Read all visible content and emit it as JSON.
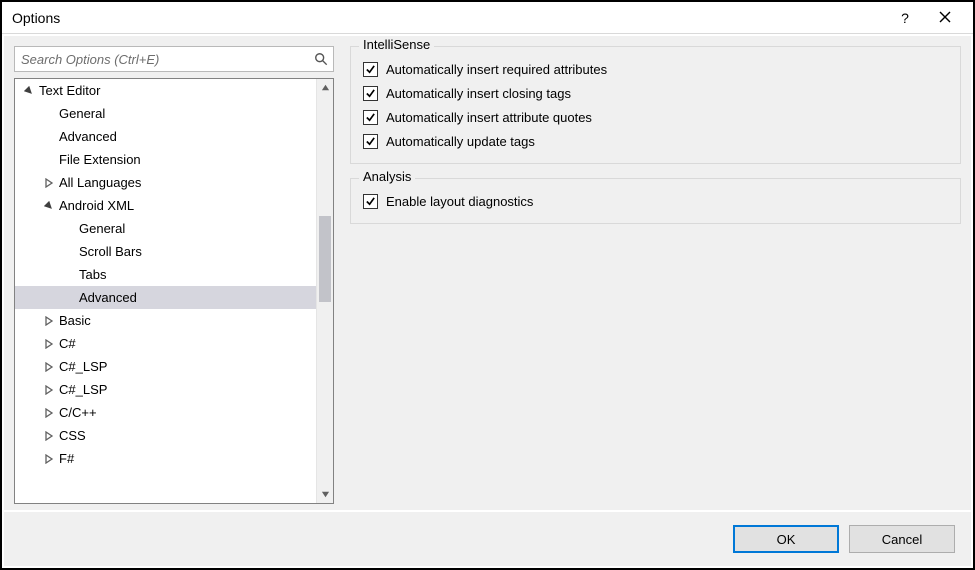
{
  "window": {
    "title": "Options"
  },
  "search": {
    "placeholder": "Search Options (Ctrl+E)",
    "value": ""
  },
  "tree": [
    {
      "label": "Text Editor",
      "depth": 0,
      "expander": "open",
      "selected": false
    },
    {
      "label": "General",
      "depth": 1,
      "expander": "none",
      "selected": false
    },
    {
      "label": "Advanced",
      "depth": 1,
      "expander": "none",
      "selected": false
    },
    {
      "label": "File Extension",
      "depth": 1,
      "expander": "none",
      "selected": false
    },
    {
      "label": "All Languages",
      "depth": 1,
      "expander": "closed",
      "selected": false
    },
    {
      "label": "Android XML",
      "depth": 1,
      "expander": "open",
      "selected": false
    },
    {
      "label": "General",
      "depth": 2,
      "expander": "none",
      "selected": false
    },
    {
      "label": "Scroll Bars",
      "depth": 2,
      "expander": "none",
      "selected": false
    },
    {
      "label": "Tabs",
      "depth": 2,
      "expander": "none",
      "selected": false
    },
    {
      "label": "Advanced",
      "depth": 2,
      "expander": "none",
      "selected": true
    },
    {
      "label": "Basic",
      "depth": 1,
      "expander": "closed",
      "selected": false
    },
    {
      "label": "C#",
      "depth": 1,
      "expander": "closed",
      "selected": false
    },
    {
      "label": "C#_LSP",
      "depth": 1,
      "expander": "closed",
      "selected": false
    },
    {
      "label": "C#_LSP",
      "depth": 1,
      "expander": "closed",
      "selected": false
    },
    {
      "label": "C/C++",
      "depth": 1,
      "expander": "closed",
      "selected": false
    },
    {
      "label": "CSS",
      "depth": 1,
      "expander": "closed",
      "selected": false
    },
    {
      "label": "F#",
      "depth": 1,
      "expander": "closed",
      "selected": false
    }
  ],
  "groups": [
    {
      "legend": "IntelliSense",
      "options": [
        {
          "label": "Automatically insert required attributes",
          "checked": true
        },
        {
          "label": "Automatically insert closing tags",
          "checked": true
        },
        {
          "label": "Automatically insert attribute quotes",
          "checked": true
        },
        {
          "label": "Automatically update tags",
          "checked": true
        }
      ]
    },
    {
      "legend": "Analysis",
      "options": [
        {
          "label": "Enable layout diagnostics",
          "checked": true
        }
      ]
    }
  ],
  "buttons": {
    "ok": "OK",
    "cancel": "Cancel"
  }
}
